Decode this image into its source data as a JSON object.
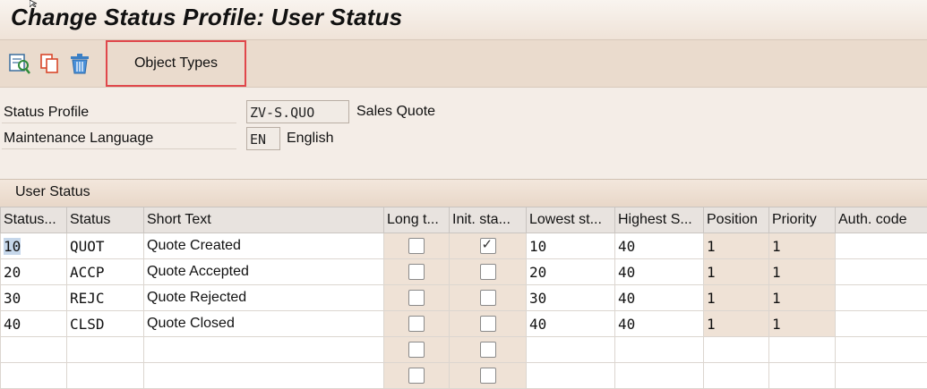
{
  "window": {
    "title": "Change Status Profile: User Status"
  },
  "toolbar": {
    "icons": [
      "display-change-icon",
      "copy-icon",
      "delete-icon"
    ],
    "object_types_label": "Object Types"
  },
  "form": {
    "status_profile": {
      "label": "Status Profile",
      "value": "ZV-S.QUO",
      "description": "Sales Quote"
    },
    "maintenance_language": {
      "label": "Maintenance Language",
      "value": "EN",
      "description": "English"
    }
  },
  "user_status": {
    "section_title": "User Status",
    "columns": [
      "Status...",
      "Status",
      "Short Text",
      "Long t...",
      "Init. sta...",
      "Lowest st...",
      "Highest S...",
      "Position",
      "Priority",
      "Auth. code"
    ],
    "rows": [
      {
        "number": "10",
        "status": "QUOT",
        "short_text": "Quote Created",
        "long_text": false,
        "initial": true,
        "lowest": "10",
        "highest": "40",
        "position": "1",
        "priority": "1",
        "auth": ""
      },
      {
        "number": "20",
        "status": "ACCP",
        "short_text": "Quote Accepted",
        "long_text": false,
        "initial": false,
        "lowest": "20",
        "highest": "40",
        "position": "1",
        "priority": "1",
        "auth": ""
      },
      {
        "number": "30",
        "status": "REJC",
        "short_text": "Quote Rejected",
        "long_text": false,
        "initial": false,
        "lowest": "30",
        "highest": "40",
        "position": "1",
        "priority": "1",
        "auth": ""
      },
      {
        "number": "40",
        "status": "CLSD",
        "short_text": "Quote Closed",
        "long_text": false,
        "initial": false,
        "lowest": "40",
        "highest": "40",
        "position": "1",
        "priority": "1",
        "auth": ""
      }
    ],
    "empty_rows": 2
  },
  "colors": {
    "highlight_border": "#e0474b",
    "background": "#f4ede7",
    "toolbar": "#eadbcd",
    "selection": "#c6d7ea"
  }
}
